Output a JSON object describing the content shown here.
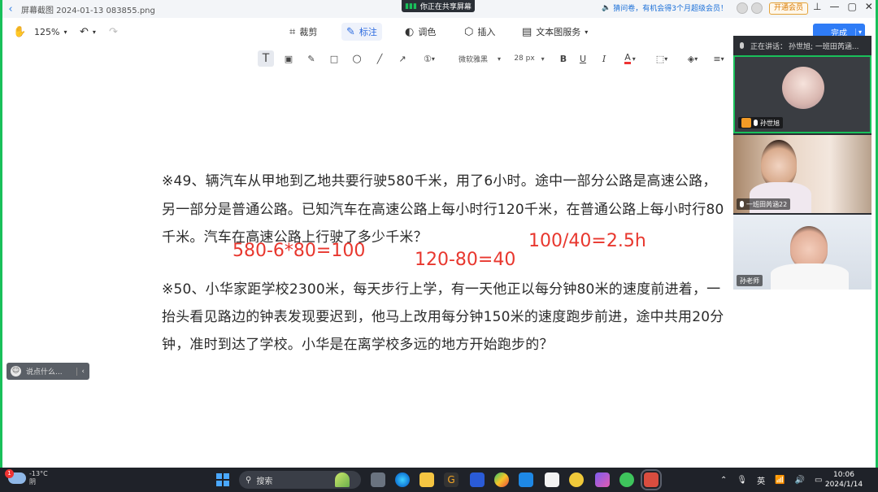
{
  "titlebar": {
    "file_title": "屏幕截图 2024-01-13 083855.png",
    "share_banner": "你正在共享屏幕",
    "promo": "猜问卷，有机会得3个月超级会员！",
    "vip_button": "开通会员"
  },
  "toolbar": {
    "zoom": "125%",
    "crop_label": "裁剪",
    "annotate_label": "标注",
    "adjust_label": "调色",
    "insert_label": "插入",
    "text_service_label": "文本图服务",
    "done_label": "完成"
  },
  "format": {
    "font_name": "微软雅黑",
    "font_size": "28 px",
    "bold": "B",
    "underline": "U",
    "italic": "I",
    "color_a": "A",
    "text_tool": "T",
    "accent_color": "#e8372e"
  },
  "document": {
    "q49_line1": "※49、辆汽车从甲地到乙地共要行驶580千米，用了6小时。途中一部分公路是高速公路，",
    "q49_line2": "另一部分是普通公路。已知汽车在高速公路上每小时行120千米，在普通公路上每小时行80",
    "q49_line3": "千米。汽车在高速公路上行驶了多少千米？",
    "q50_line1": "※50、小华家距学校2300米，每天步行上学，有一天他正以每分钟80米的速度前进着，一",
    "q50_line2": "抬头看见路边的钟表发现要迟到，他马上改用每分钟150米的速度跑步前进，途中共用20分",
    "q50_line3": "钟，准时到达了学校。小华是在离学校多远的地方开始跑步的？"
  },
  "annotations": {
    "a1": "580-6*80=100",
    "a2": "120-80=40",
    "a3": "100/40=2.5h"
  },
  "floating_pill": {
    "text": "说点什么..."
  },
  "video_panel": {
    "speaking_label": "正在讲话：",
    "speaking_names": "孙世旭; 一班田芮涵...",
    "p1_name": "孙世旭",
    "p2_name": "一班田芮涵22",
    "p3_name": "孙老师"
  },
  "taskbar": {
    "temperature": "-13°C",
    "weather": "阴",
    "weather_badge": "1",
    "search_placeholder": "搜索",
    "ime": "英",
    "time": "10:06",
    "date": "2024/1/14"
  }
}
